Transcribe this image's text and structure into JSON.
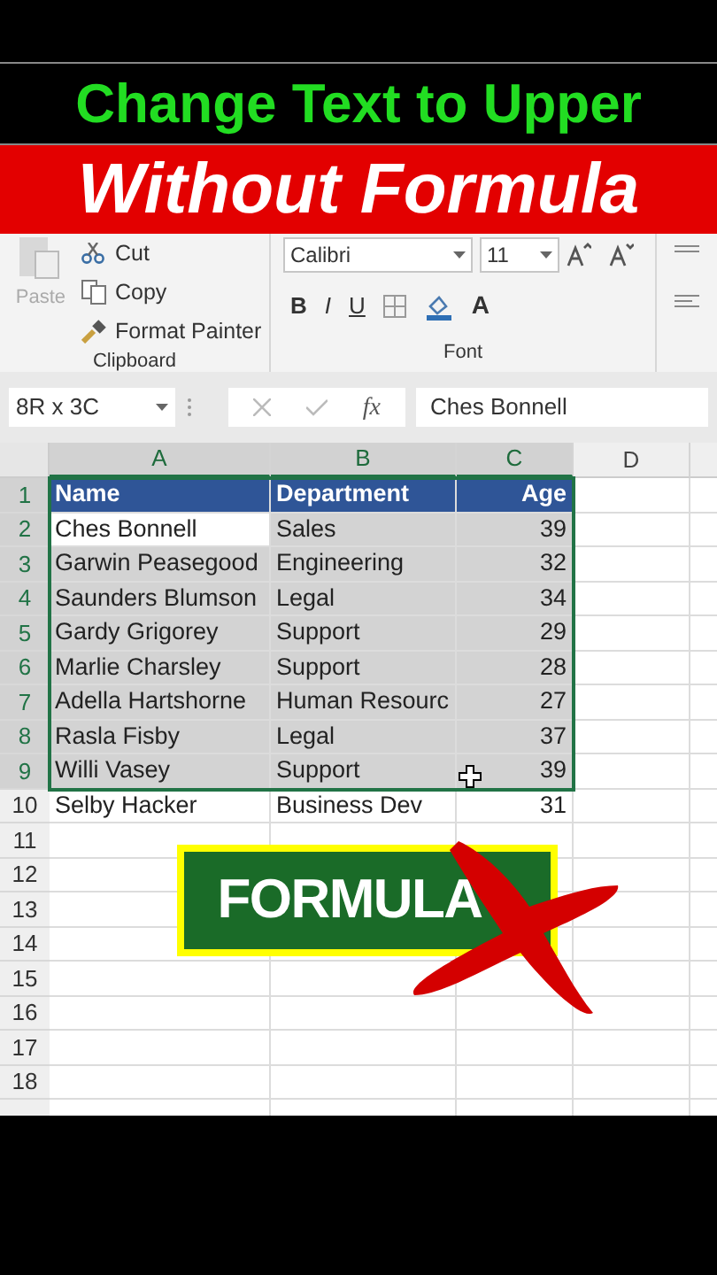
{
  "banner": {
    "title": "Change Text to Upper",
    "subtitle": "Without Formula"
  },
  "ribbon": {
    "clipboard": {
      "paste": "Paste",
      "items": [
        {
          "kind": "cut",
          "label": "Cut"
        },
        {
          "kind": "copy",
          "label": "Copy"
        },
        {
          "kind": "painter",
          "label": "Format Painter"
        }
      ],
      "label": "Clipboard"
    },
    "font": {
      "font_name": "Calibri",
      "font_size": "11",
      "bold": "B",
      "italic": "I",
      "underline": "U",
      "font_color": "A",
      "label": "Font"
    }
  },
  "formula_bar": {
    "name_box": "8R x 3C",
    "fx": "fx",
    "content": "Ches Bonnell"
  },
  "grid": {
    "columns": [
      {
        "label": "A",
        "selected": true
      },
      {
        "label": "B",
        "selected": true
      },
      {
        "label": "C",
        "selected": true
      },
      {
        "label": "D",
        "selected": false
      }
    ],
    "rows": [
      {
        "number": "1",
        "kind": "header",
        "selected": true,
        "cells": [
          {
            "text": "Name",
            "active": false
          },
          {
            "text": "Department",
            "active": false
          },
          {
            "text": "Age",
            "active": false
          }
        ]
      },
      {
        "number": "2",
        "kind": "data",
        "selected": true,
        "cells": [
          {
            "text": "Ches Bonnell",
            "active": true
          },
          {
            "text": "Sales",
            "active": false
          },
          {
            "text": "39",
            "active": false
          }
        ]
      },
      {
        "number": "3",
        "kind": "data",
        "selected": true,
        "cells": [
          {
            "text": "Garwin Peasegood",
            "active": false
          },
          {
            "text": "Engineering",
            "active": false
          },
          {
            "text": "32",
            "active": false
          }
        ]
      },
      {
        "number": "4",
        "kind": "data",
        "selected": true,
        "cells": [
          {
            "text": "Saunders Blumson",
            "active": false
          },
          {
            "text": "Legal",
            "active": false
          },
          {
            "text": "34",
            "active": false
          }
        ]
      },
      {
        "number": "5",
        "kind": "data",
        "selected": true,
        "cells": [
          {
            "text": "Gardy Grigorey",
            "active": false
          },
          {
            "text": "Support",
            "active": false
          },
          {
            "text": "29",
            "active": false
          }
        ]
      },
      {
        "number": "6",
        "kind": "data",
        "selected": true,
        "cells": [
          {
            "text": "Marlie Charsley",
            "active": false
          },
          {
            "text": "Support",
            "active": false
          },
          {
            "text": "28",
            "active": false
          }
        ]
      },
      {
        "number": "7",
        "kind": "data",
        "selected": true,
        "cells": [
          {
            "text": "Adella Hartshorne",
            "active": false
          },
          {
            "text": "Human Resourc",
            "active": false
          },
          {
            "text": "27",
            "active": false
          }
        ]
      },
      {
        "number": "8",
        "kind": "data",
        "selected": true,
        "cells": [
          {
            "text": "Rasla Fisby",
            "active": false
          },
          {
            "text": "Legal",
            "active": false
          },
          {
            "text": "37",
            "active": false
          }
        ]
      },
      {
        "number": "9",
        "kind": "data",
        "selected": true,
        "cells": [
          {
            "text": "Willi Vasey",
            "active": false
          },
          {
            "text": "Support",
            "active": false
          },
          {
            "text": "39",
            "active": false
          }
        ]
      },
      {
        "number": "10",
        "kind": "data",
        "selected": false,
        "cells": [
          {
            "text": "Selby Hacker",
            "active": false
          },
          {
            "text": "Business Dev",
            "active": false
          },
          {
            "text": "31",
            "active": false
          }
        ]
      }
    ],
    "empty_rows": [
      "11",
      "12",
      "13",
      "14",
      "15",
      "16",
      "17",
      "18"
    ]
  },
  "overlay": {
    "label": "FORMULA"
  }
}
